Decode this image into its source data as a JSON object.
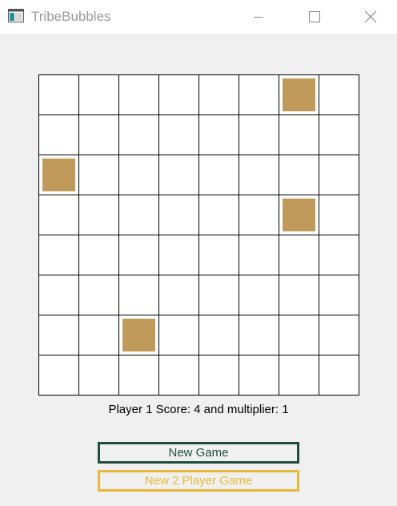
{
  "window": {
    "title": "TribeBubbles",
    "app_icon": "app-icon",
    "controls": [
      "minimize-icon",
      "maximize-icon",
      "close-icon"
    ]
  },
  "board": {
    "rows": 8,
    "cols": 8,
    "piece_color": "#bf9a5b",
    "grid_color": "#000000",
    "pieces": [
      {
        "row": 0,
        "col": 6
      },
      {
        "row": 2,
        "col": 0
      },
      {
        "row": 3,
        "col": 6
      },
      {
        "row": 6,
        "col": 2
      }
    ]
  },
  "status": {
    "text": "Player 1 Score: 4 and multiplier: 1"
  },
  "buttons": {
    "new_game": "New Game",
    "new_2_player": "New 2 Player Game"
  },
  "colors": {
    "new_game_border": "#1f4d3c",
    "new_2_player_border": "#e8b936"
  }
}
